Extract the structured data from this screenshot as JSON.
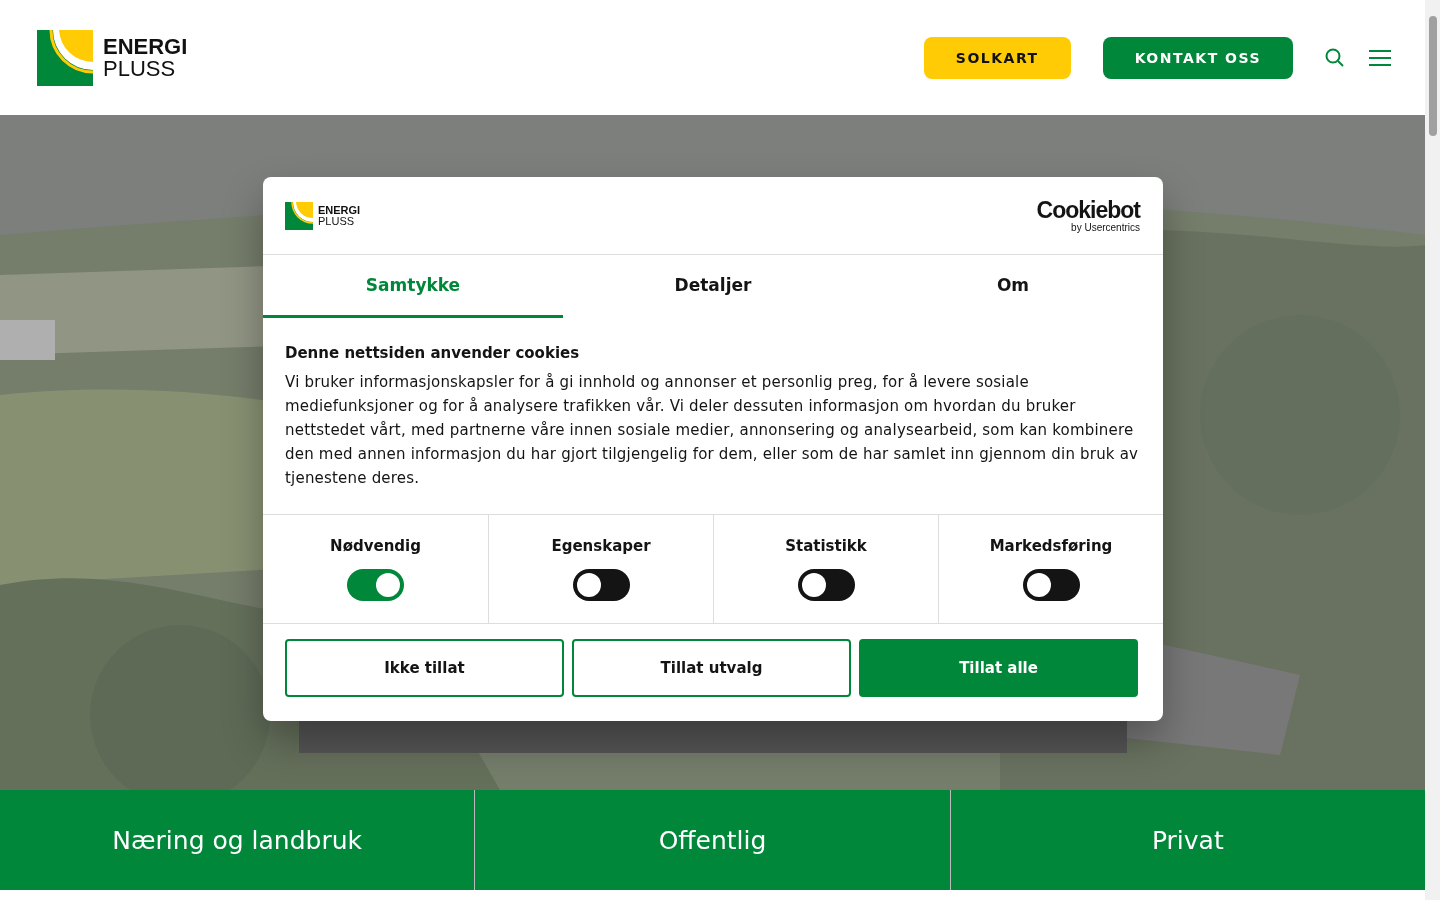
{
  "header": {
    "logo": {
      "line1": "ENERGI",
      "line2": "PLUSS"
    },
    "buttons": [
      {
        "label": "SOLKART",
        "kind": "yellow"
      },
      {
        "label": "KONTAKT OSS",
        "kind": "green"
      }
    ]
  },
  "hero": {
    "kind": "picture"
  },
  "categories": [
    "Næring og landbruk",
    "Offentlig",
    "Privat"
  ],
  "cookie_dialog": {
    "logo": {
      "line1": "ENERGI",
      "line2": "PLUSS"
    },
    "provider": {
      "name": "Cookiebot",
      "byline": "by Usercentrics"
    },
    "tabs": [
      {
        "label": "Samtykke",
        "selected": true
      },
      {
        "label": "Detaljer",
        "selected": false
      },
      {
        "label": "Om",
        "selected": false
      }
    ],
    "heading": "Denne nettsiden anvender cookies",
    "body": "Vi bruker informasjonskapsler for å gi innhold og annonser et personlig preg, for å levere sosiale mediefunksjoner og for å analysere trafikken vår. Vi deler dessuten informasjon om hvordan du bruker nettstedet vårt, med partnerne våre innen sosiale medier, annonsering og analysearbeid, som kan kombinere den med annen informasjon du har gjort tilgjengelig for dem, eller som de har samlet inn gjennom din bruk av tjenestene deres.",
    "toggles": [
      {
        "label": "Nødvendig",
        "on": true
      },
      {
        "label": "Egenskaper",
        "on": false
      },
      {
        "label": "Statistikk",
        "on": false
      },
      {
        "label": "Markedsføring",
        "on": false
      }
    ],
    "buttons": [
      {
        "label": "Ikke tillat",
        "kind": "outline"
      },
      {
        "label": "Tillat utvalg",
        "kind": "outline"
      },
      {
        "label": "Tillat alle",
        "kind": "filled"
      }
    ]
  }
}
